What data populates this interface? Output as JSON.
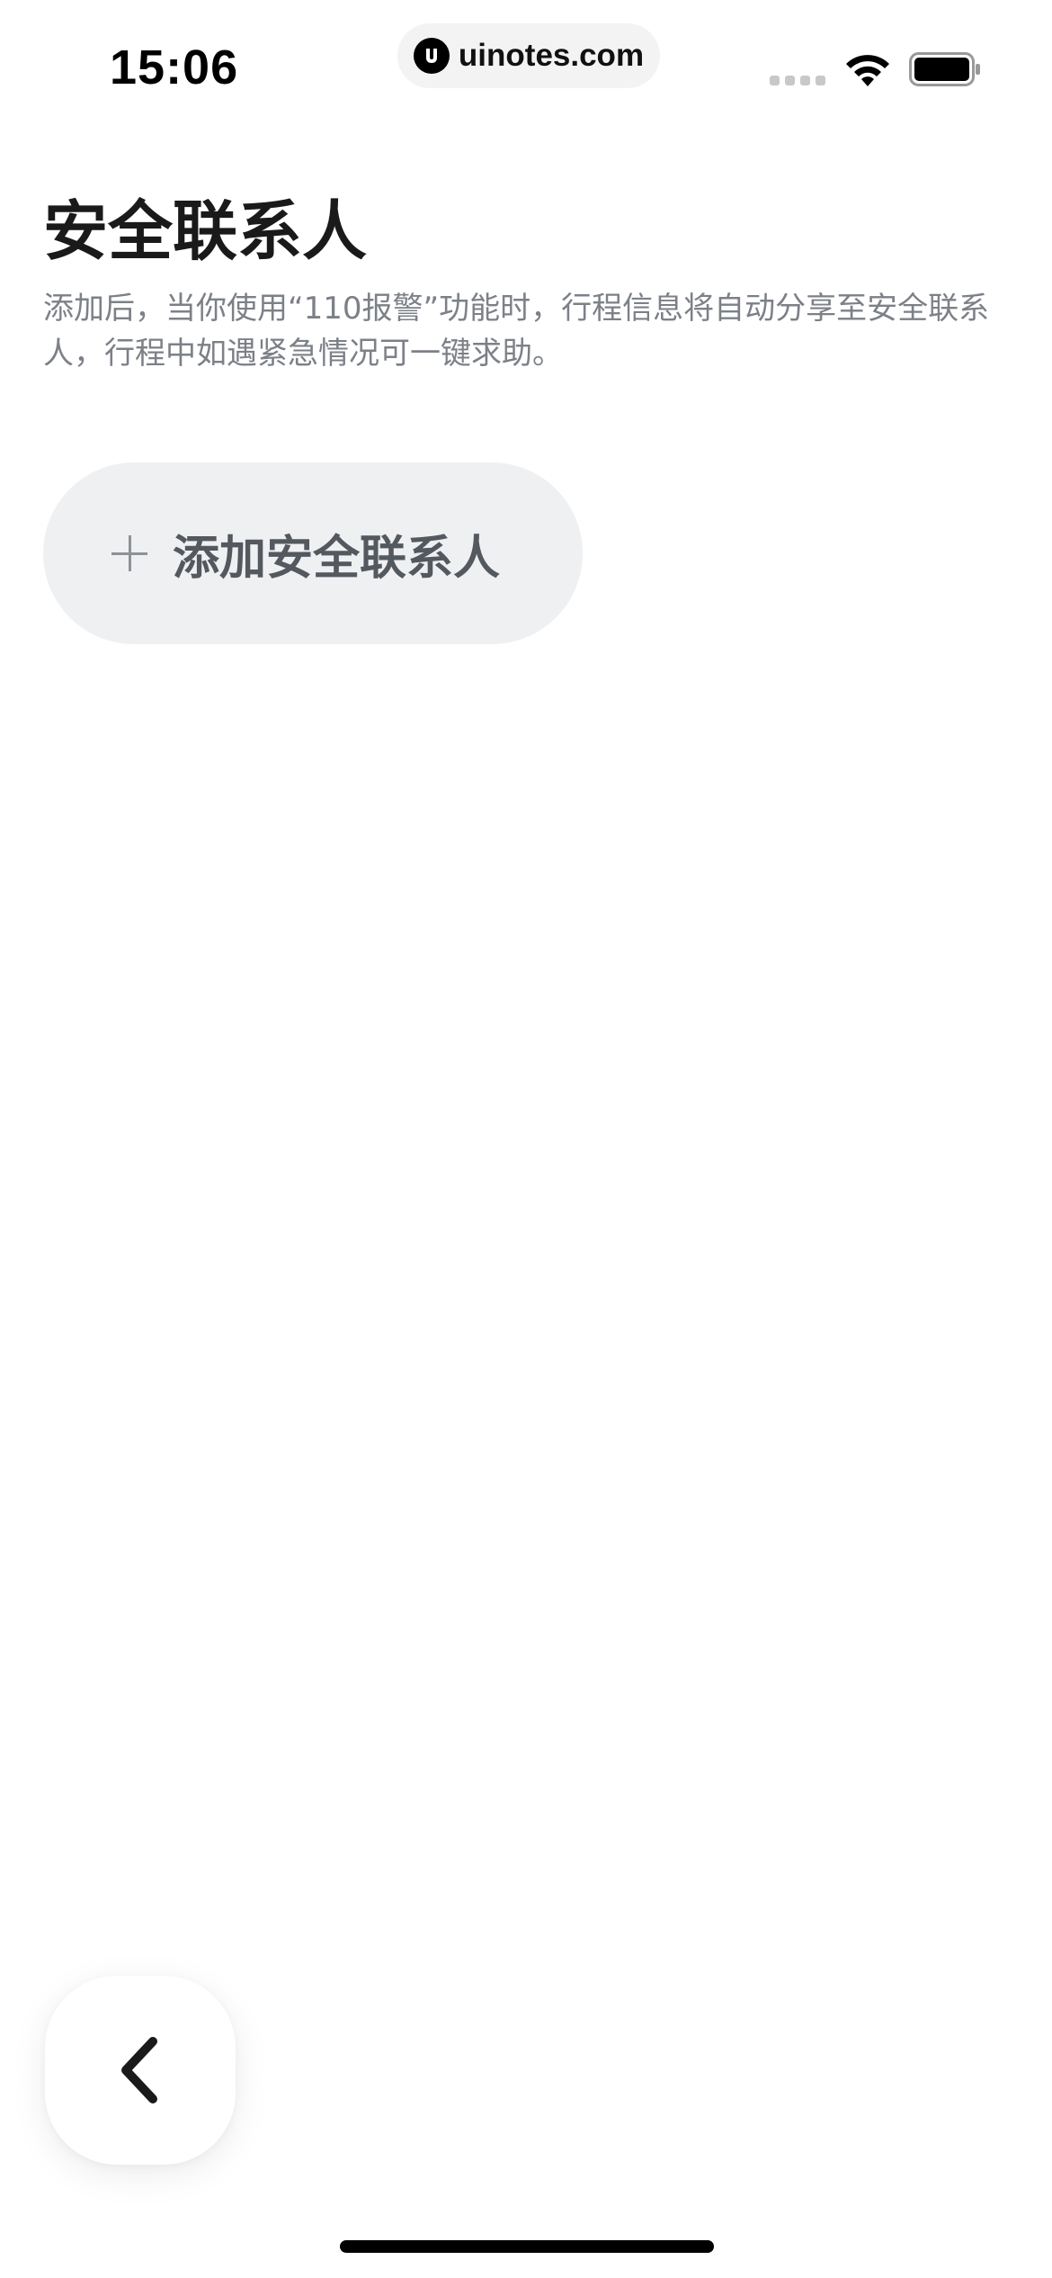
{
  "status_bar": {
    "time": "15:06",
    "url": "uinotes.com"
  },
  "page": {
    "title": "安全联系人",
    "description": "添加后，当你使用“110报警”功能时，行程信息将自动分享至安全联系人，行程中如遇紧急情况可一键求助。",
    "add_button_label": "添加安全联系人"
  },
  "icons": {
    "plus": "plus-icon",
    "back": "chevron-left-icon",
    "wifi": "wifi-icon",
    "battery": "battery-icon",
    "signal": "signal-icon"
  },
  "colors": {
    "title": "#1a1a1a",
    "description": "#7c8087",
    "button_bg": "#eff0f2",
    "button_text": "#54585f"
  }
}
